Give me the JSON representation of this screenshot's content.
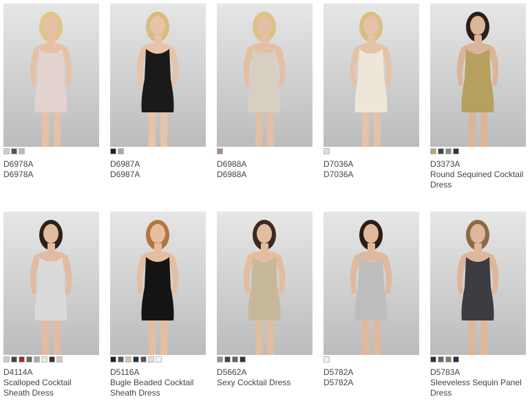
{
  "products": [
    {
      "code": "D6978A",
      "name": "D6978A",
      "dress": "#e3d3cf",
      "skin": "#e6c1a6",
      "hair": "#e0c488",
      "swatches": [
        "#d8c9c5",
        "#555555",
        "#bbbbbb"
      ]
    },
    {
      "code": "D6987A",
      "name": "D6987A",
      "dress": "#1a1a1a",
      "skin": "#e7c3a8",
      "hair": "#d8bb7e",
      "swatches": [
        "#222222",
        "#a8a8a8"
      ]
    },
    {
      "code": "D6988A",
      "name": "D6988A",
      "dress": "#d7cfc2",
      "skin": "#e4bfa3",
      "hair": "#dcc189",
      "swatches": [
        "#a58c80"
      ]
    },
    {
      "code": "D7036A",
      "name": "D7036A",
      "dress": "#eee6d8",
      "skin": "#e6c2a6",
      "hair": "#d9bd84",
      "swatches": [
        "#e5ddd0"
      ]
    },
    {
      "code": "D3373A",
      "name": "Round Sequined Cocktail Dress",
      "dress": "#b5a060",
      "skin": "#dcb496",
      "hair": "#2a1f1a",
      "swatches": [
        "#bba66a",
        "#444444",
        "#888888",
        "#333333"
      ]
    },
    {
      "code": "D4114A",
      "name": "Scalloped Cocktail Sheath Dress",
      "dress": "#dadada",
      "skin": "#e2bba0",
      "hair": "#2b201a",
      "swatches": [
        "#cccccc",
        "#444444",
        "#a52a2a",
        "#666666",
        "#aaaaaa",
        "#e8e8e8",
        "#333333",
        "#d9c7b8"
      ]
    },
    {
      "code": "D5116A",
      "name": "Bugle Beaded Cocktail Sheath Dress",
      "dress": "#141414",
      "skin": "#e5bea0",
      "hair": "#b0773d",
      "swatches": [
        "#222222",
        "#555555",
        "#d4c4a6",
        "#203050",
        "#555555",
        "#dddddd",
        "#f4f4f4"
      ]
    },
    {
      "code": "D5662A",
      "name": "Sexy Cocktail Dress",
      "dress": "#c8b89a",
      "skin": "#e2bd9f",
      "hair": "#3a2a20",
      "swatches": [
        "#9a9284",
        "#444444",
        "#556677",
        "#333333"
      ]
    },
    {
      "code": "D5782A",
      "name": "D5782A",
      "dress": "#bdbdbd",
      "skin": "#e0b99c",
      "hair": "#2a1d15",
      "swatches": [
        "#f4f0f0"
      ]
    },
    {
      "code": "D5783A",
      "name": "Sleeveless Sequin Panel Dress",
      "dress": "#3c3c42",
      "skin": "#dfb699",
      "hair": "#8d6a45",
      "swatches": [
        "#333333",
        "#666666",
        "#8a7a66",
        "#2a3040"
      ]
    }
  ]
}
